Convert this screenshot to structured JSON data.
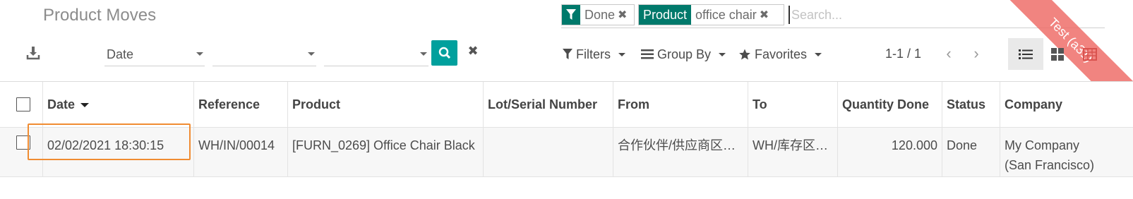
{
  "page": {
    "title": "Product Moves"
  },
  "ribbon": {
    "text": "Test (a31)"
  },
  "search": {
    "facets": [
      {
        "category": "Done",
        "category_icon": "filter-icon",
        "values": ""
      },
      {
        "category": "Product",
        "values": "office chair"
      }
    ],
    "placeholder": "Search..."
  },
  "toolbar": {
    "download_icon": "download-icon",
    "field1": "Date",
    "field2": "",
    "field3": "",
    "filters_label": "Filters",
    "groupby_label": "Group By",
    "favorites_label": "Favorites",
    "pager": "1-1 / 1"
  },
  "table": {
    "columns": [
      "Date",
      "Reference",
      "Product",
      "Lot/Serial Number",
      "From",
      "To",
      "Quantity Done",
      "Status",
      "Company"
    ],
    "sorted_column": "Date",
    "rows": [
      {
        "date": "02/02/2021 18:30:15",
        "reference": "WH/IN/00014",
        "product": "[FURN_0269] Office Chair Black",
        "lot": "",
        "from": "合作伙伴/供应商区…",
        "to": "WH/库存区…",
        "quantity": "120.000",
        "status": "Done",
        "company_line1": "My Company",
        "company_line2": "(San Francisco)"
      }
    ]
  },
  "colors": {
    "accent": "#00a09d",
    "facet": "#00796b",
    "highlight": "#f08c32",
    "ribbon": "#ef6f6a"
  }
}
